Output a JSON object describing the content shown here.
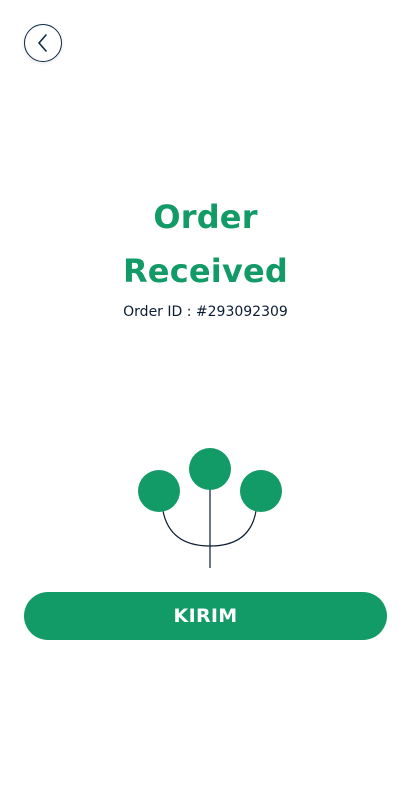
{
  "header": {
    "back_icon": "chevron-left-icon"
  },
  "main": {
    "title_line1": "Order",
    "title_line2": "Received",
    "order_id_text": "Order ID : #293092309"
  },
  "illustration": {
    "icon": "tree-icon"
  },
  "actions": {
    "primary_label": "KIRIM"
  },
  "colors": {
    "accent": "#129a67",
    "dark": "#0b1d33",
    "background": "#ffffff"
  }
}
